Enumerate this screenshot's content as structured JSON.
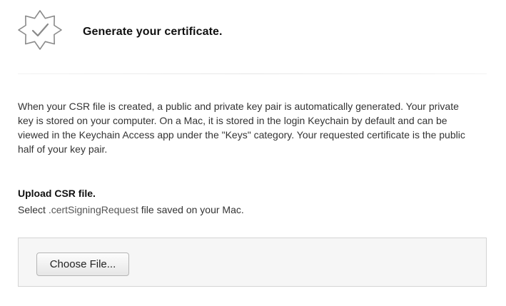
{
  "header": {
    "icon": "certificate-badge-check-icon",
    "title": "Generate your certificate."
  },
  "description": "When your CSR file is created, a public and private key pair is automatically generated. Your private key is stored on your computer. On a Mac, it is stored in the login Keychain by default and can be viewed in the Keychain Access app under the \"Keys\" category. Your requested certificate is the public half of your key pair.",
  "upload": {
    "title": "Upload CSR file.",
    "desc_prefix": "Select ",
    "desc_code": ".certSigningRequest",
    "desc_suffix": " file saved on your Mac.",
    "button_label": "Choose File..."
  },
  "colors": {
    "icon_stroke": "#8a8a8a",
    "panel_bg": "#f6f6f6",
    "panel_border": "#d4d4d4"
  }
}
